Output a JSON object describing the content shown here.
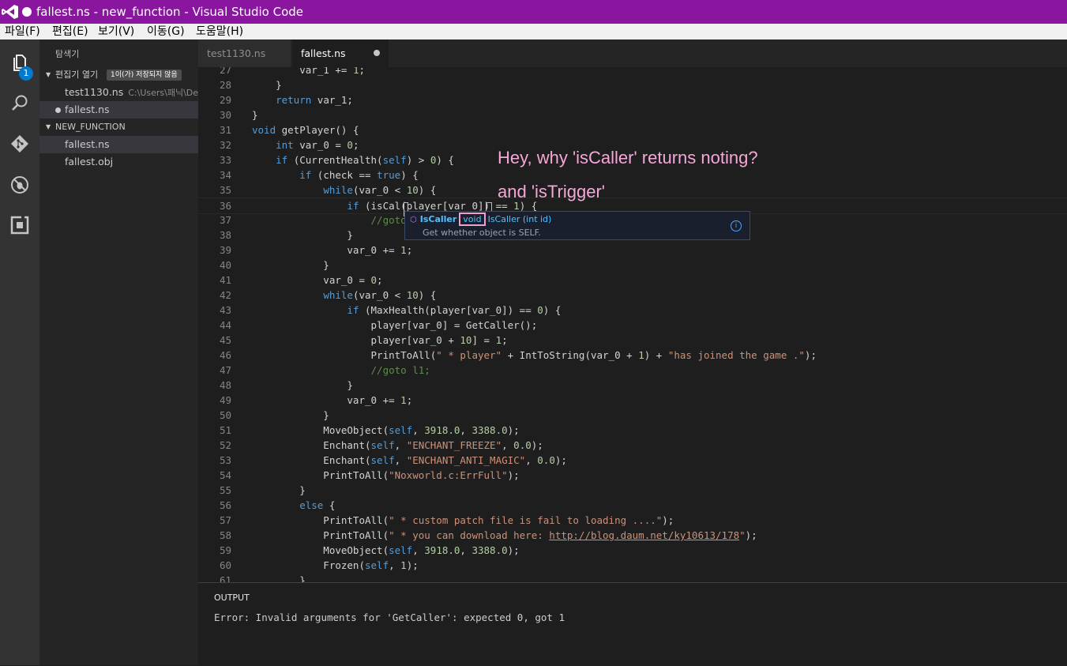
{
  "window": {
    "title": "fallest.ns - new_function - Visual Studio Code"
  },
  "menu": [
    "파일(F)",
    "편집(E)",
    "보기(V)",
    "이동(G)",
    "도움말(H)"
  ],
  "activity": {
    "explorer_badge": "1",
    "icons": [
      "files-icon",
      "search-icon",
      "git-icon",
      "debug-icon",
      "extensions-icon"
    ]
  },
  "sidebar": {
    "title": "탐색기",
    "open_editors": {
      "label": "편집기 열기",
      "badge": "1이(가) 저장되지 않음",
      "items": [
        {
          "name": "test1130.ns",
          "path": "C:\\Users\\패닉\\De..."
        },
        {
          "name": "fallest.ns",
          "path": ""
        }
      ]
    },
    "folder": {
      "label": "NEW_FUNCTION",
      "items": [
        {
          "name": "fallest.ns"
        },
        {
          "name": "fallest.obj"
        }
      ]
    }
  },
  "tabs": [
    {
      "label": "test1130.ns"
    },
    {
      "label": "fallest.ns"
    }
  ],
  "editor": {
    "first_line": 27,
    "current_line": 36,
    "lines": [
      "        var_1 += 1;",
      "    }",
      "    return var_1;",
      "}",
      "void getPlayer() {",
      "    int var_0 = 0;",
      "    if (CurrentHealth(self) > 0) {",
      "        if (check == true) {",
      "            while(var_0 < 10) {",
      "                if (isCal(player[var_0]) == 1) {",
      "                    //goto",
      "                }",
      "                var_0 += 1;",
      "            }",
      "            var_0 = 0;",
      "            while(var_0 < 10) {",
      "                if (MaxHealth(player[var_0]) == 0) {",
      "                    player[var_0] = GetCaller();",
      "                    player[var_0 + 10] = 1;",
      "                    PrintToAll(\" * player\" + IntToString(var_0 + 1) + \"has joined the game .\");",
      "                    //goto l1;",
      "                }",
      "                var_0 += 1;",
      "            }",
      "            MoveObject(self, 3918.0, 3388.0);",
      "            Enchant(self, \"ENCHANT_FREEZE\", 0.0);",
      "            Enchant(self, \"ENCHANT_ANTI_MAGIC\", 0.0);",
      "            PrintToAll(\"Noxworld.c:ErrFull\");",
      "        }",
      "        else {",
      "            PrintToAll(\" * custom patch file is fail to loading ....\");",
      "            PrintToAll(\" * you can download here: http://blog.daum.net/ky10613/178\");",
      "            MoveObject(self, 3918.0, 3388.0);",
      "            Frozen(self, 1);",
      "        }"
    ],
    "link": "http://blog.daum.net/ky10613/178"
  },
  "annotations": {
    "line1": "Hey, why 'isCaller' returns noting?",
    "line2": "and 'isTrigger'"
  },
  "hover": {
    "name": "IsCaller",
    "type": "void",
    "detail": "IsCaller (int id)",
    "doc": "Get whether object is SELF."
  },
  "panel": {
    "title": "OUTPUT",
    "output": "Error: Invalid arguments for 'GetCaller': expected 0, got 1"
  }
}
